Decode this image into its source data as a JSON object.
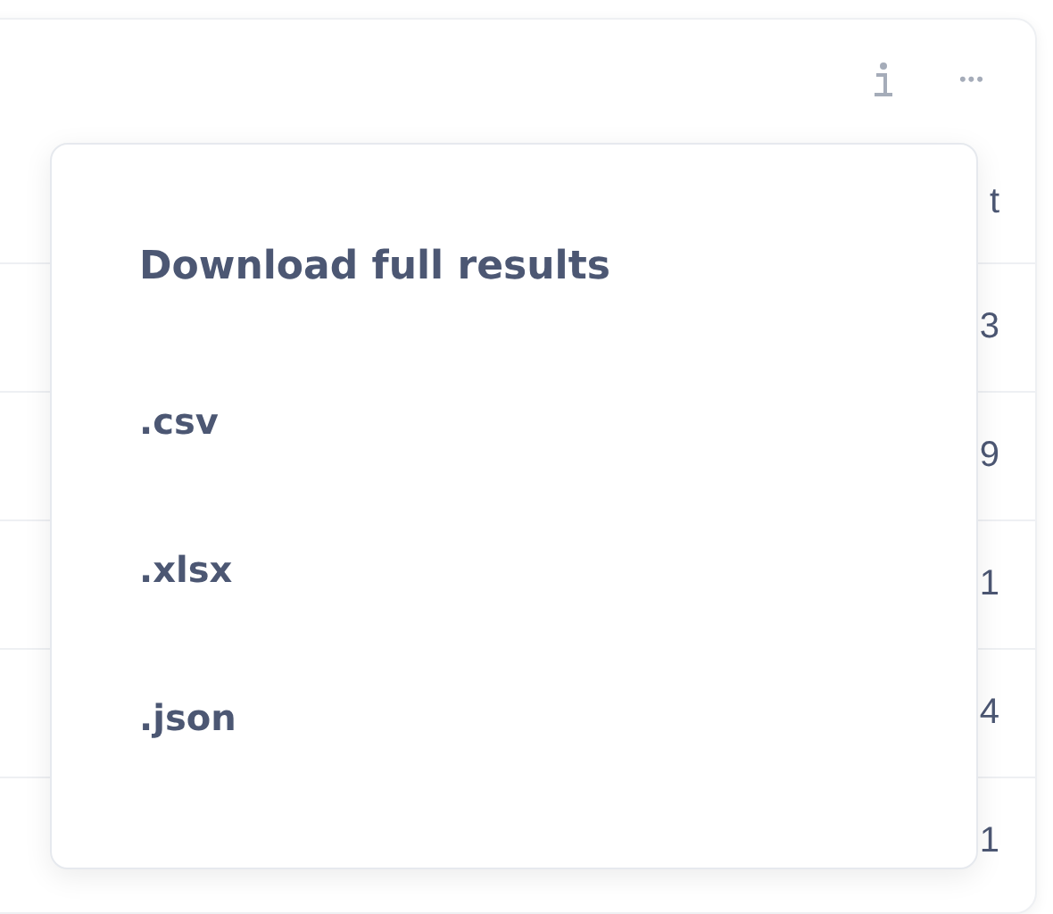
{
  "table": {
    "column_header": "t",
    "cells": [
      "3",
      "9",
      "1",
      "4",
      "1"
    ]
  },
  "toolbar": {
    "more_icon": "•••"
  },
  "download_menu": {
    "title": "Download full results",
    "formats": [
      ".csv",
      ".xlsx",
      ".json"
    ]
  }
}
